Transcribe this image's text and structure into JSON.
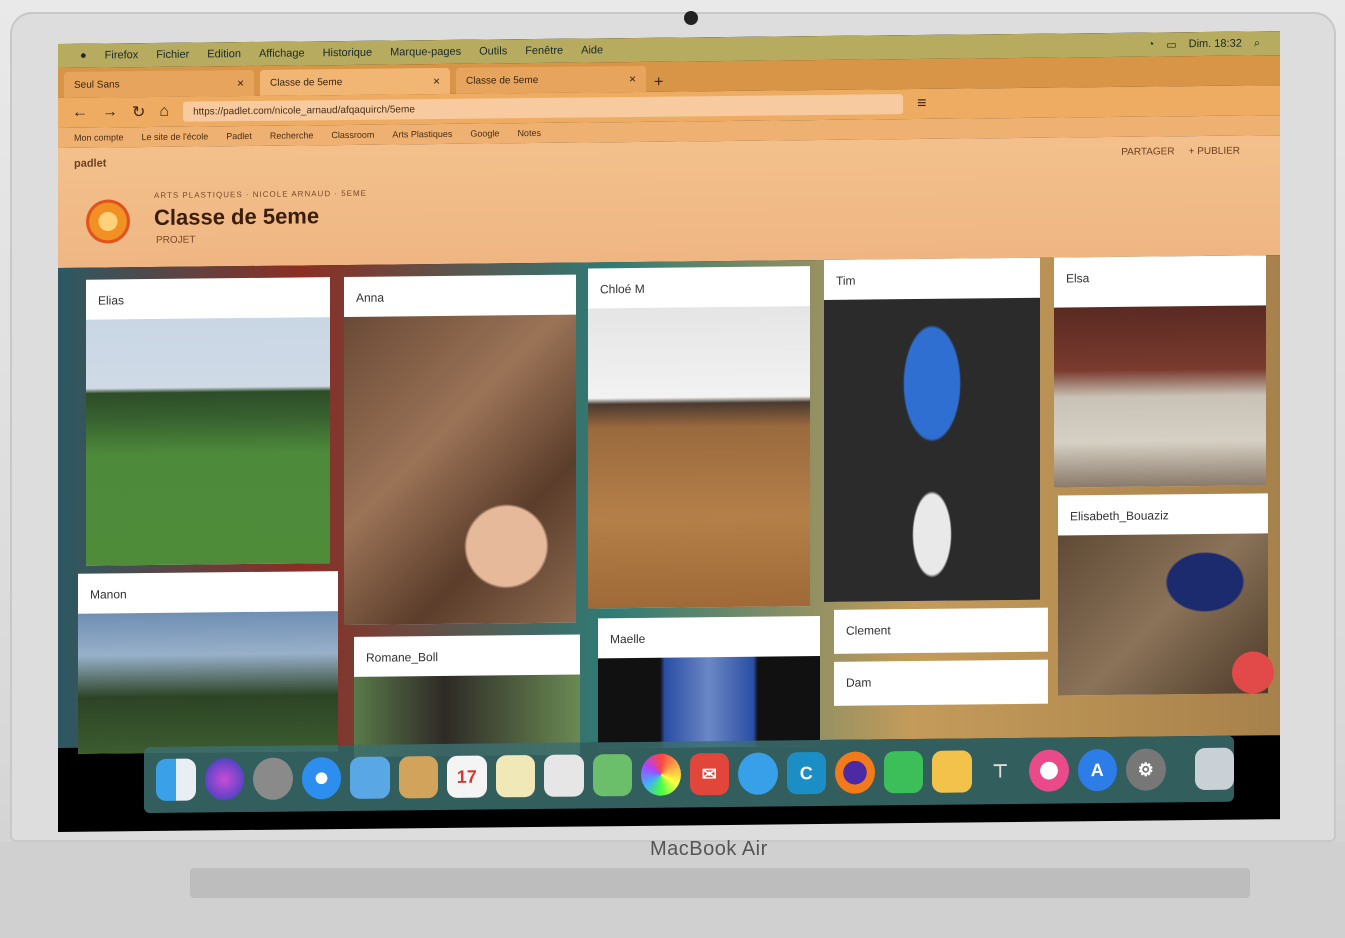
{
  "menubar": {
    "items": [
      "Firefox",
      "Fichier",
      "Edition",
      "Affichage",
      "Historique",
      "Marque-pages",
      "Outils",
      "Fenêtre",
      "Aide"
    ],
    "clock": "Dim. 18:32"
  },
  "browser": {
    "tabs": [
      {
        "label": "Seul Sans"
      },
      {
        "label": "Classe de 5eme"
      },
      {
        "label": "Classe de 5eme"
      }
    ],
    "url": "https://padlet.com/nicole_arnaud/afqaquirch/5eme",
    "bookmarks": [
      "Mon compte",
      "Le site de l'école",
      "Padlet",
      "Recherche",
      "Classroom",
      "Arts Plastiques",
      "Google",
      "Notes"
    ]
  },
  "padlet": {
    "brand": "padlet",
    "top_links": [
      "PARTAGER",
      "+ PUBLIER"
    ],
    "breadcrumb": "ARTS PLASTIQUES · NICOLE ARNAUD · 5EME",
    "title": "Classe de 5eme",
    "subtitle": "PROJET",
    "cards": [
      {
        "name": "Elias"
      },
      {
        "name": "Anna"
      },
      {
        "name": "Chloé M"
      },
      {
        "name": "Tim"
      },
      {
        "name": "Elsa"
      },
      {
        "name": "Elisabeth_Bouaziz"
      },
      {
        "name": "Manon"
      },
      {
        "name": "Romane_Boll"
      },
      {
        "name": "Maelle"
      },
      {
        "name": "Clement"
      },
      {
        "name": "Dam"
      }
    ]
  },
  "dock": {
    "apps": [
      "finder-icon",
      "siri-icon",
      "launchpad-icon",
      "safari-icon",
      "photos-icon",
      "notes-icon",
      "calendar-icon",
      "textedit-icon",
      "preview-icon",
      "maps-icon",
      "photos2-icon",
      "mail-icon",
      "messages-icon",
      "c-app-icon",
      "firefox-icon",
      "facetime-icon",
      "pages-icon",
      "keynote-icon",
      "itunes-icon",
      "appstore-icon",
      "preferences-icon",
      "trash-icon"
    ]
  },
  "laptop": {
    "brand": "MacBook Air"
  }
}
